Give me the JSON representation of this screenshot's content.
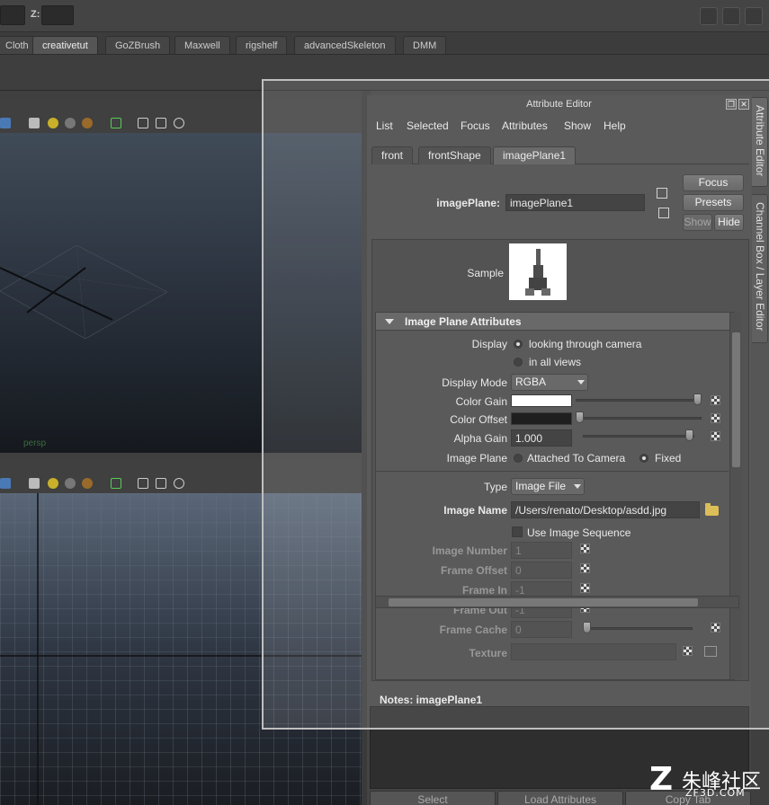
{
  "topbar": {
    "z_label": "Z:"
  },
  "shelf_tabs": [
    "Cloth",
    "creativetut",
    "GoZBrush",
    "Maxwell",
    "rigshelf",
    "advancedSkeleton",
    "DMM"
  ],
  "viewport": {
    "top_label": "persp"
  },
  "attribute_editor": {
    "title": "Attribute Editor",
    "menu": [
      "List",
      "Selected",
      "Focus",
      "Attributes",
      "Show",
      "Help"
    ],
    "tabs": [
      "front",
      "frontShape",
      "imagePlane1"
    ],
    "node_type_label": "imagePlane:",
    "node_name": "imagePlane1",
    "buttons": {
      "focus": "Focus",
      "presets": "Presets",
      "show": "Show",
      "hide": "Hide"
    },
    "sample_label": "Sample",
    "section_title": "Image Plane Attributes",
    "display": {
      "label": "Display",
      "option_camera": "looking through camera",
      "option_all": "in all views"
    },
    "display_mode": {
      "label": "Display Mode",
      "value": "RGBA"
    },
    "color_gain": {
      "label": "Color Gain",
      "color": "#ffffff"
    },
    "color_offset": {
      "label": "Color Offset",
      "color": "#000000"
    },
    "alpha_gain": {
      "label": "Alpha Gain",
      "value": "1.000"
    },
    "image_plane": {
      "label": "Image Plane",
      "option_attached": "Attached To Camera",
      "option_fixed": "Fixed"
    },
    "type": {
      "label": "Type",
      "value": "Image File"
    },
    "image_name": {
      "label": "Image Name",
      "value": "/Users/renato/Desktop/asdd.jpg"
    },
    "use_sequence_label": "Use Image Sequence",
    "image_number": {
      "label": "Image Number",
      "value": "1"
    },
    "frame_offset": {
      "label": "Frame Offset",
      "value": "0"
    },
    "frame_in": {
      "label": "Frame In",
      "value": "-1"
    },
    "frame_out": {
      "label": "Frame Out",
      "value": "-1"
    },
    "frame_cache": {
      "label": "Frame Cache",
      "value": "0"
    },
    "texture_label": "Texture",
    "notes_label": "Notes:  imagePlane1",
    "bottom_buttons": [
      "Select",
      "Load Attributes",
      "Copy Tab"
    ]
  },
  "side_tabs": [
    "Attribute Editor",
    "Channel Box / Layer Editor"
  ],
  "watermark": {
    "logo": "Z",
    "cn": "朱峰社区",
    "en": "ZF3D.COM"
  }
}
